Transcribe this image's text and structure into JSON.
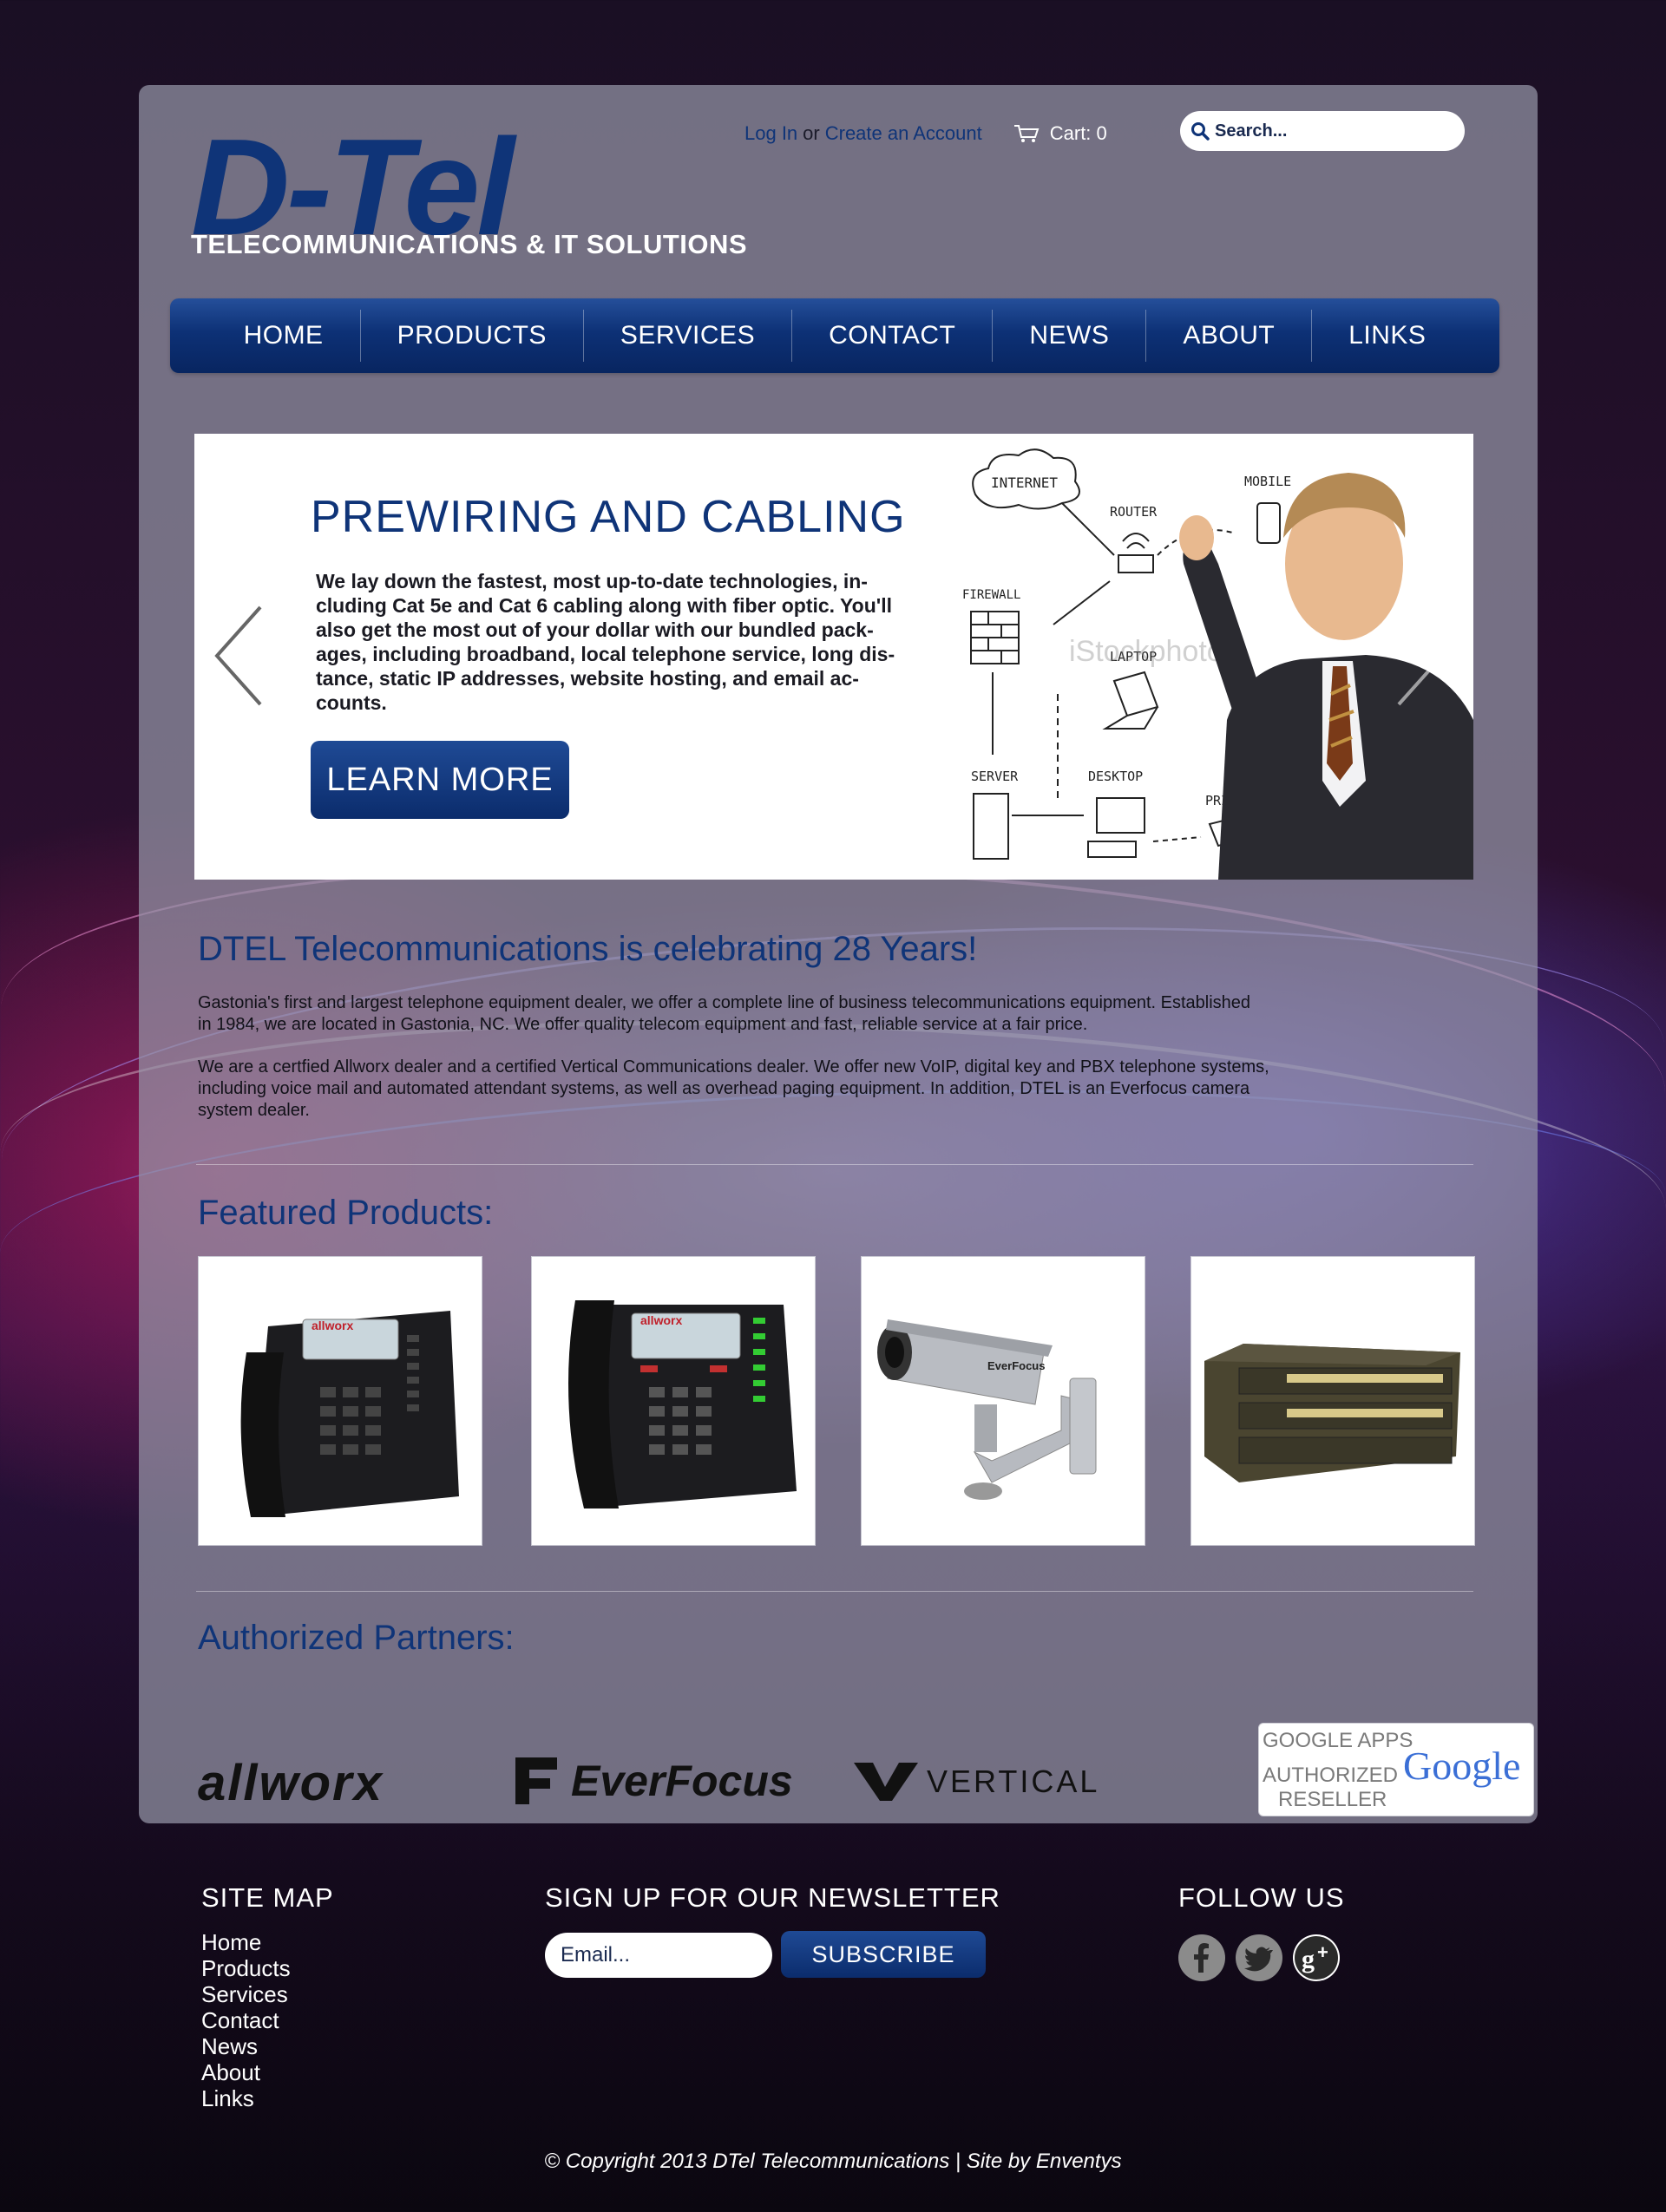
{
  "colors": {
    "brand_navy": "#0f3478",
    "nav_gradient_top": "#254f9a",
    "nav_gradient_bottom": "#082560",
    "panel": "#9696a8",
    "footer_text": "#ffffff"
  },
  "header": {
    "logo_mark": "D-Tel",
    "logo_tagline": "TELECOMMUNICATIONS & IT SOLUTIONS",
    "login_label": "Log In",
    "or_label": "or",
    "create_account_label": "Create an Account",
    "cart_icon": "cart-icon",
    "cart_label": "Cart: 0",
    "search_placeholder": "Search...",
    "search_icon": "search-icon"
  },
  "nav": {
    "items": [
      {
        "label": "HOME"
      },
      {
        "label": "PRODUCTS"
      },
      {
        "label": "SERVICES"
      },
      {
        "label": "CONTACT"
      },
      {
        "label": "NEWS"
      },
      {
        "label": "ABOUT"
      },
      {
        "label": "LINKS"
      }
    ]
  },
  "slider": {
    "title": "PREWIRING AND CABLING",
    "text_lines": [
      "We lay down the fastest, most up-to-date technologies, in-",
      "cluding Cat 5e and Cat 6 cabling along with fiber optic. You'll",
      "also get the most out of your dollar with our bundled pack-",
      "ages, including broadband, local telephone service, long dis-",
      "tance, static IP addresses, website hosting, and email ac-",
      "counts."
    ],
    "button_label": "LEARN MORE",
    "prev_icon": "chevron-left-icon",
    "next_icon": "chevron-right-icon",
    "diagram_labels": {
      "internet": "INTERNET",
      "router": "ROUTER",
      "mobile": "MOBILE",
      "firewall": "FIREWALL",
      "laptop": "LAPTOP",
      "server": "SERVER",
      "desktop": "DESKTOP",
      "printer": "PRINTER",
      "watermark": "iStockphoto"
    }
  },
  "about": {
    "heading": "DTEL Telecommunications is celebrating 28 Years!",
    "paragraph1_lines": [
      "Gastonia's first and largest telephone equipment dealer, we offer a complete line of business telecommunications equipment. Established",
      "in 1984, we are located in Gastonia, NC. We offer quality telecom equipment and fast, reliable service at a fair price."
    ],
    "paragraph2_lines": [
      "We are a certfied Allworx dealer and a certified Vertical Communications dealer. We offer new VoIP, digital key and PBX telephone systems,",
      "including voice mail and automated attendant systems, as well as overhead paging equipment. In addition, DTEL is an Everfocus camera",
      "system dealer."
    ]
  },
  "featured": {
    "heading": "Featured Products:",
    "products": [
      {
        "name": "allworx-phone-1",
        "brand_text": "allworx"
      },
      {
        "name": "allworx-phone-2",
        "brand_text": "allworx"
      },
      {
        "name": "everfocus-camera",
        "brand_text": "EverFocus"
      },
      {
        "name": "vertical-switch",
        "brand_text": ""
      }
    ]
  },
  "partners": {
    "heading": "Authorized Partners:",
    "allworx": "allworx",
    "everfocus": "EverFocus",
    "vertical": "VERTICAL",
    "google_badge": {
      "line1": "GOOGLE APPS",
      "line2": "AUTHORIZED",
      "line3": "RESELLER",
      "google": "Google"
    }
  },
  "footer": {
    "sitemap_heading": "SITE MAP",
    "sitemap_links": [
      "Home",
      "Products",
      "Services",
      "Contact",
      "News",
      "About",
      "Links"
    ],
    "newsletter_heading": "SIGN UP FOR OUR NEWSLETTER",
    "email_placeholder": "Email...",
    "subscribe_label": "SUBSCRIBE",
    "follow_heading": "FOLLOW US",
    "social_icons": [
      "facebook-icon",
      "twitter-icon",
      "google-plus-icon"
    ],
    "copyright": "© Copyright 2013 DTel Telecommunications  |  Site by Enventys"
  }
}
